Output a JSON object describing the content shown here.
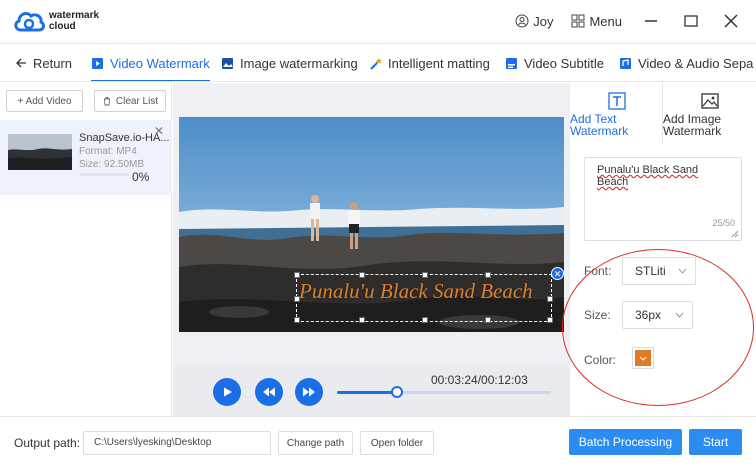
{
  "app": {
    "name_line1": "watermark",
    "name_line2": "cloud",
    "user": "Joy",
    "menu_label": "Menu"
  },
  "nav": {
    "return_label": "Return",
    "tabs": [
      {
        "label": "Video Watermark",
        "icon": "video-icon",
        "active": true
      },
      {
        "label": "Image watermarking",
        "icon": "image-icon",
        "active": false
      },
      {
        "label": "Intelligent matting",
        "icon": "magic-wand-icon",
        "active": false
      },
      {
        "label": "Video Subtitle",
        "icon": "subtitle-icon",
        "active": false
      },
      {
        "label": "Video & Audio Sepa",
        "icon": "audio-video-icon",
        "active": false
      }
    ]
  },
  "file_list": {
    "add_label": "+ Add Video",
    "clear_label": "Clear List",
    "items": [
      {
        "name": "SnapSave.io-HA...",
        "format": "Format:  MP4",
        "size": "Size:  92.50MB",
        "progress": "0%"
      }
    ]
  },
  "preview": {
    "watermark_text": "Punalu'u Black Sand Beach",
    "time": "00:03:24/00:12:03",
    "progress_fraction": 0.282
  },
  "panel": {
    "tab_text": "Add Text Watermark",
    "tab_image": "Add Image Watermark",
    "text_value": "Punalu'u Black Sand Beach",
    "char_count": "25/50",
    "font_label": "Font:",
    "font_value": "STLiti",
    "size_label": "Size:",
    "size_value": "36px",
    "color_label": "Color:",
    "color_value": "#e07b24"
  },
  "bottom": {
    "output_label": "Output path:",
    "output_path": "C:\\Users\\lyesking\\Desktop",
    "change_path": "Change path",
    "open_folder": "Open folder",
    "batch": "Batch Processing",
    "start": "Start"
  },
  "colors": {
    "accent": "#1a6fe6",
    "button": "#2d8cf0",
    "annotation": "#d93025"
  }
}
